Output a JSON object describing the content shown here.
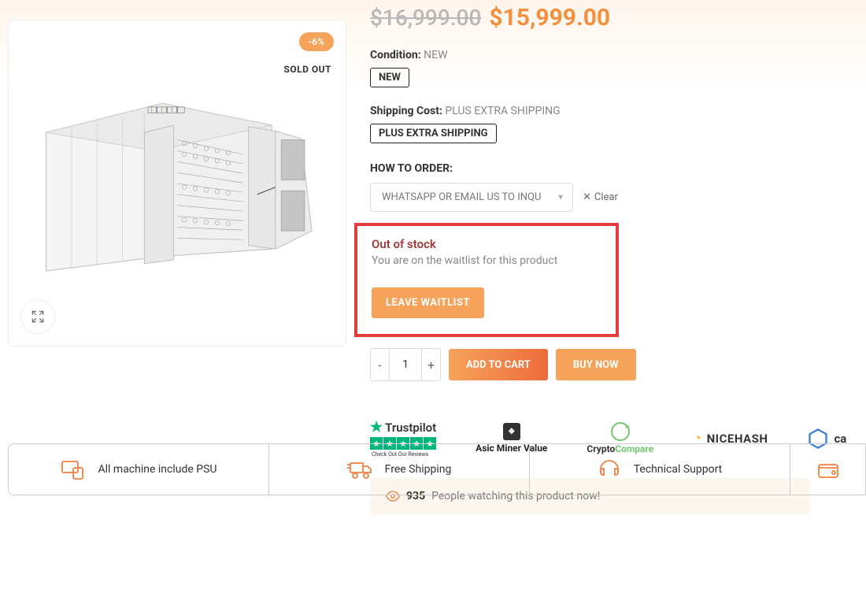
{
  "pricing": {
    "original": "$16,999.00",
    "sale": "$15,999.00",
    "discount_badge": "-6%"
  },
  "badges": {
    "sold_out": "SOLD OUT"
  },
  "condition": {
    "label": "Condition:",
    "value": "NEW",
    "chip": "NEW"
  },
  "shipping": {
    "label": "Shipping Cost:",
    "value": "PLUS EXTRA SHIPPING",
    "chip": "PLUS EXTRA SHIPPING"
  },
  "how_to_order": {
    "label": "HOW TO ORDER:",
    "selected": "WHATSAPP OR EMAIL US TO INQU",
    "clear": "Clear"
  },
  "waitlist": {
    "out_of_stock": "Out of stock",
    "message": "You are on the waitlist for this product",
    "leave_btn": "LEAVE WAITLIST"
  },
  "cart": {
    "qty": "1",
    "add_to_cart": "ADD TO CART",
    "buy_now": "BUY NOW"
  },
  "trust": {
    "trustpilot": {
      "name": "Trustpilot",
      "sub": "Check Out Our Reviews"
    },
    "amv": "Asic Miner Value",
    "crypto_compare": {
      "p1": "Crypto",
      "p2": "Compare"
    },
    "nicehash": "NICEHASH",
    "ca": "ca"
  },
  "watching": {
    "count": "935",
    "text": "People watching this product now!"
  },
  "benefits": [
    {
      "text": "All machine include PSU"
    },
    {
      "text": "Free Shipping"
    },
    {
      "text": "Technical Support"
    }
  ]
}
